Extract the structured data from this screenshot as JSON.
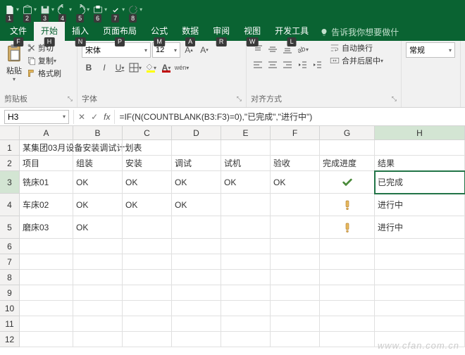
{
  "qat": [
    "1",
    "2",
    "3",
    "4",
    "5",
    "6",
    "7",
    "8"
  ],
  "tabs": [
    {
      "label": "文件",
      "key": "F"
    },
    {
      "label": "开始",
      "key": "H",
      "active": true
    },
    {
      "label": "插入",
      "key": "N"
    },
    {
      "label": "页面布局",
      "key": "P"
    },
    {
      "label": "公式",
      "key": "M"
    },
    {
      "label": "数据",
      "key": "A"
    },
    {
      "label": "审阅",
      "key": "R"
    },
    {
      "label": "视图",
      "key": "W"
    },
    {
      "label": "开发工具",
      "key": "L"
    }
  ],
  "tellme": "告诉我你想要做什",
  "ribbon": {
    "clipboard": {
      "paste": "粘贴",
      "cut": "剪切",
      "copy": "复制",
      "painter": "格式刷",
      "group": "剪贴板"
    },
    "font": {
      "name": "宋体",
      "size": "12",
      "group": "字体",
      "fill": "#ffff00",
      "color": "#c00000"
    },
    "align": {
      "wrap": "自动换行",
      "merge": "合并后居中",
      "group": "对齐方式"
    },
    "number": {
      "format": "常规"
    }
  },
  "namebox": "H3",
  "formula": "=IF(N(COUNTBLANK(B3:F3)=0),\"已完成\",\"进行中\")",
  "columns": [
    "A",
    "B",
    "C",
    "D",
    "E",
    "F",
    "G",
    "H"
  ],
  "sheet": {
    "r1": {
      "A": "某集团03月设备安装调试计划表"
    },
    "r2": {
      "A": "项目",
      "B": "组装",
      "C": "安装",
      "D": "调试",
      "E": "试机",
      "F": "验收",
      "G": "完成进度",
      "H": "结果"
    },
    "r3": {
      "A": "铣床01",
      "B": "OK",
      "C": "OK",
      "D": "OK",
      "E": "OK",
      "F": "OK",
      "G": "check",
      "H": "已完成"
    },
    "r4": {
      "A": "车床02",
      "B": "OK",
      "C": "OK",
      "D": "OK",
      "G": "warn",
      "H": "进行中"
    },
    "r5": {
      "A": "磨床03",
      "B": "OK",
      "G": "warn",
      "H": "进行中"
    }
  },
  "watermark": "www.cfan.com.cn"
}
